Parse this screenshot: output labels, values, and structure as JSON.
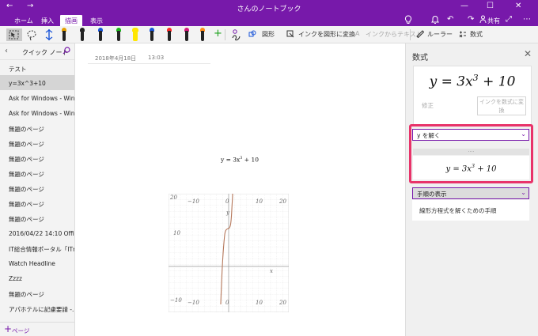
{
  "window": {
    "title": "さんのノートブック",
    "back_icon": "←",
    "forward_icon": "→",
    "minimize_icon": "—",
    "restore_icon": "☐",
    "close_icon": "✕"
  },
  "ribbon": {
    "tabs": [
      {
        "label": "ホーム"
      },
      {
        "label": "挿入"
      },
      {
        "label": "描画"
      },
      {
        "label": "表示"
      }
    ],
    "active_tab": "描画",
    "share_label": "共有",
    "pen_colors": [
      "#111111",
      "#2b2b2b",
      "#3a3a3a",
      "#1f1f1f",
      "#ffe600",
      "#111111",
      "#111111",
      "#111111",
      "#111111",
      "#111111",
      "#111111"
    ],
    "pen_tip_colors": [
      "#e6a000",
      "#222222",
      "#1a55d8",
      "#1a55d8",
      "#ffe600",
      "#ff2a2a",
      "#19b819",
      "#1a7fd8",
      "#d81a7f",
      "#ff8c1a",
      "#7a7a7a"
    ],
    "shapes_label": "図形",
    "ink_to_shape_label": "インクを図形に変換",
    "ink_to_text_label": "インクからテキスト",
    "ruler_label": "ルーラー",
    "math_label": "数式"
  },
  "sidebar": {
    "title": "クイック ノート",
    "pages": [
      {
        "label": "テスト"
      },
      {
        "label": "y=3x^3+10"
      },
      {
        "label": "Ask for Windows - Win..."
      },
      {
        "label": "Ask for Windows - Win..."
      },
      {
        "label": "無題のページ"
      },
      {
        "label": "無題のページ"
      },
      {
        "label": "無題のページ"
      },
      {
        "label": "無題のページ"
      },
      {
        "label": "無題のページ"
      },
      {
        "label": "無題のページ"
      },
      {
        "label": "無題のページ"
      },
      {
        "label": "2016/04/22 14:10 Offic..."
      },
      {
        "label": "IT総合情報ポータル「ITm..."
      },
      {
        "label": "Watch Headline"
      },
      {
        "label": "Zzzz"
      },
      {
        "label": "無題のページ"
      },
      {
        "label": "アパホテルに記慮要請 -..."
      }
    ],
    "selected_index": 1,
    "add_page_label": "ページ"
  },
  "note": {
    "date": "2018年4月18日",
    "time": "13:03",
    "equation": {
      "lhs": "y = 3x",
      "exp": "3",
      "rhs": " + 10"
    },
    "graph": {
      "y_ticks": [
        "20",
        "10",
        "0",
        "−10"
      ],
      "x_ticks": [
        "−10",
        "0",
        "10",
        "20"
      ],
      "x_axis_label": "x",
      "y_axis_label": "y"
    }
  },
  "math_pane": {
    "title": "数式",
    "equation": {
      "lhs": "y = 3x",
      "exp": "3",
      "rhs": " + 10"
    },
    "fix_label": "修正",
    "convert_label": "インクを数式に変換",
    "solve_select": "y を解く",
    "grip": "....",
    "solution": {
      "lhs": "y = 3x",
      "exp": "3",
      "rhs": " + 10"
    },
    "steps_select": "手順の表示",
    "steps_text": "線形方程式を解くための手順"
  },
  "colors": {
    "accent": "#7719aa",
    "highlight": "#e8336a"
  }
}
